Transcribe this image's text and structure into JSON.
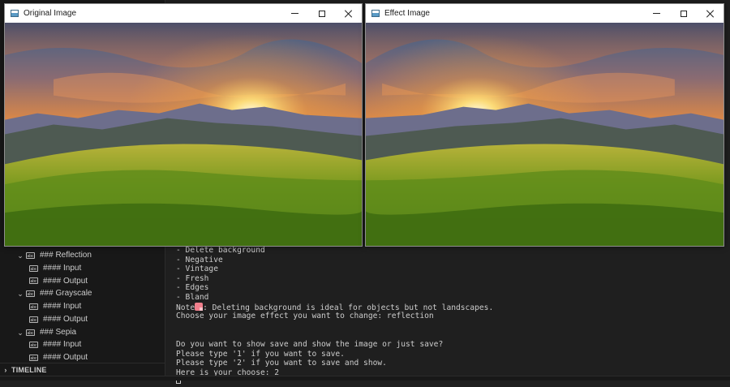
{
  "windows": {
    "original": {
      "title": "Original Image"
    },
    "effect": {
      "title": "Effect Image"
    }
  },
  "outline": {
    "items": [
      {
        "level": 1,
        "label": "### Reflection"
      },
      {
        "level": 2,
        "label": "#### Input"
      },
      {
        "level": 2,
        "label": "#### Output"
      },
      {
        "level": 1,
        "label": "### Grayscale"
      },
      {
        "level": 2,
        "label": "#### Input"
      },
      {
        "level": 2,
        "label": "#### Output"
      },
      {
        "level": 1,
        "label": "### Sepia"
      },
      {
        "level": 2,
        "label": "#### Input"
      },
      {
        "level": 2,
        "label": "#### Output"
      }
    ],
    "timeline_label": "TIMELINE"
  },
  "terminal": {
    "lines": [
      "- Delete background",
      "- Negative",
      "- Vintage",
      "- Fresh",
      "- Edges",
      "- Bland",
      "Note",
      "Choose your image effect you want to change: reflection",
      "",
      "",
      "Do you want to show save and show the image or just save?",
      "Please type '1' if you want to save.",
      "Please type '2' if you want to save and show.",
      "Here is your choose: 2"
    ],
    "note_rest": ": Deleting background is ideal for objects but not landscapes."
  },
  "colors": {
    "editor_bg": "#1f1f1f",
    "sidebar_bg": "#181818",
    "titlebar_bg": "#ffffff"
  }
}
